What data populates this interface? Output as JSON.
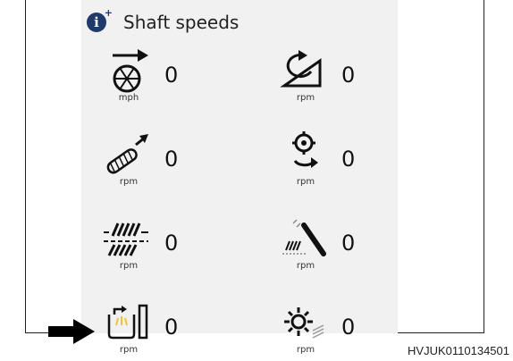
{
  "header": {
    "title": "Shaft speeds"
  },
  "speeds": [
    {
      "id": "ground-speed",
      "icon": "ground-speed-wheel-icon",
      "value": "0",
      "unit": "mph"
    },
    {
      "id": "rotor-speed",
      "icon": "rotor-rotation-icon",
      "value": "0",
      "unit": "rpm"
    },
    {
      "id": "feeder-speed",
      "icon": "feeder-chain-icon",
      "value": "0",
      "unit": "rpm"
    },
    {
      "id": "beater-speed",
      "icon": "beater-gear-icon",
      "value": "0",
      "unit": "rpm"
    },
    {
      "id": "chopper-speed",
      "icon": "straw-chopper-icon",
      "value": "0",
      "unit": "rpm"
    },
    {
      "id": "sieve-speed",
      "icon": "sieve-icon",
      "value": "0",
      "unit": "rpm"
    },
    {
      "id": "tank-unload-speed",
      "icon": "grain-tank-icon",
      "value": "0",
      "unit": "rpm"
    },
    {
      "id": "fan-speed",
      "icon": "cleaning-fan-icon",
      "value": "0",
      "unit": "rpm"
    }
  ],
  "footer": {
    "code": "HVJUK0110134501"
  },
  "colors": {
    "panel": "#f1f1f1",
    "info": "#1f3b6e",
    "highlight": "#f4c330"
  }
}
